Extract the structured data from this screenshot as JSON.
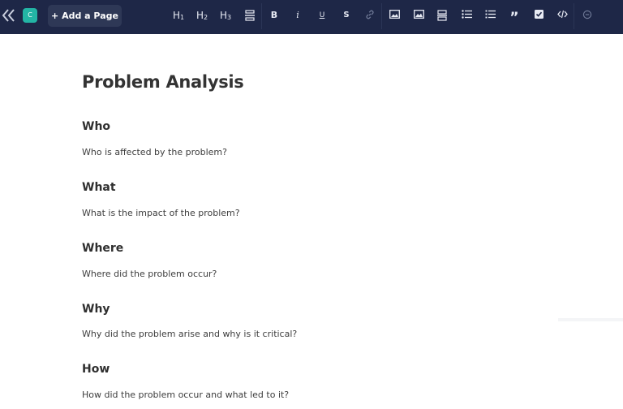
{
  "toolbar": {
    "avatar_letter": "C",
    "add_page_label": "+ Add a Page",
    "tools": [
      {
        "name": "heading-1",
        "label": "H",
        "sub": "1"
      },
      {
        "name": "heading-2",
        "label": "H",
        "sub": "2"
      },
      {
        "name": "heading-3",
        "label": "H",
        "sub": "3"
      },
      {
        "name": "bold",
        "label": "B"
      },
      {
        "name": "italic",
        "label": "i"
      },
      {
        "name": "underline",
        "label": "U"
      },
      {
        "name": "strikethrough",
        "label": "S"
      },
      {
        "name": "quote",
        "label": "”"
      }
    ],
    "colors": {
      "bar_background": "#1e2747",
      "add_page_background": "#2e3856",
      "avatar_background": "#23b5a5"
    }
  },
  "document": {
    "title": "Problem Analysis",
    "sections": [
      {
        "heading": "Who",
        "text": "Who is affected by the problem?"
      },
      {
        "heading": "What",
        "text": "What is the impact of the problem?"
      },
      {
        "heading": "Where",
        "text": "Where did the problem occur?"
      },
      {
        "heading": "Why",
        "text": "Why did the problem arise and why is it critical?"
      },
      {
        "heading": "How",
        "text": "How did the problem occur and what led to it?"
      }
    ]
  }
}
